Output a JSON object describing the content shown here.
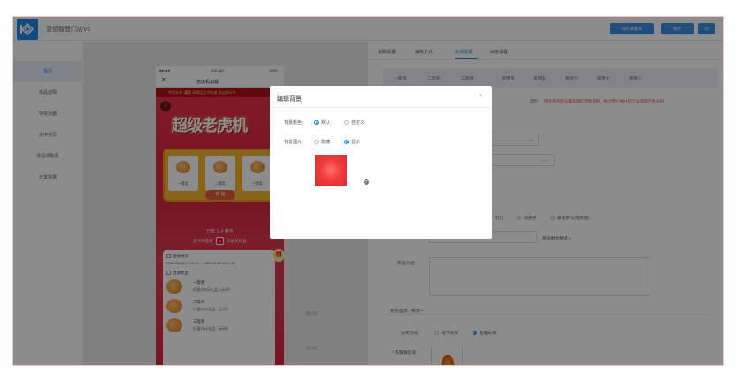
{
  "app": {
    "title": "壹佰智慧门店V2",
    "buttons": {
      "save_publish": "保存并发布",
      "save": "保存",
      "extra": "◎"
    }
  },
  "sidebar": {
    "items": [
      {
        "label": "首页",
        "active": true
      },
      {
        "label": "奖品详情"
      },
      {
        "label": "中奖页面"
      },
      {
        "label": "没中奖页"
      },
      {
        "label": "奖品领取页"
      },
      {
        "label": "分享效果"
      }
    ]
  },
  "phone": {
    "status_signal": "●●●●●",
    "status_time": "1:21 AM",
    "status_battery": "100%",
    "nav_close": "✕",
    "nav_title": "老虎机加载",
    "notice": "中奖名单: 嘉斯 获得奖品中奖者    活动进行中",
    "hero_title": "超级老虎机",
    "slots": [
      "一等奖",
      "二等奖",
      "三等奖"
    ],
    "start_button": "开 始",
    "participants": "已有 1 人参与",
    "chances_prefix": "您今天还有",
    "chances_count": "3",
    "chances_suffix": "次抽奖机会",
    "card": {
      "time_title": "活动时间",
      "time_range": "2021-09-26 11:14:54 ~ 2021-10-03 11:14:54",
      "prize_title": "活动奖品",
      "prizes": [
        {
          "name": "一等奖",
          "value": "价值100元礼品（示例）"
        },
        {
          "name": "二等奖",
          "value": "价值50元礼品（示例）"
        },
        {
          "name": "三等奖",
          "value": "价值10元礼品（示例）"
        }
      ]
    }
  },
  "hints": {
    "a": "提示项",
    "b": "提示项"
  },
  "settings": {
    "tabs": [
      "基础设置",
      "抽奖方式",
      "奖项设置",
      "高级设置"
    ],
    "active_tab": 2,
    "subtabs": [
      "一等奖",
      "二等奖",
      "三等奖",
      "奖项四",
      "奖项五",
      "奖项六",
      "奖项七",
      "奖项八"
    ],
    "tip_label": "提示:",
    "tip_text": "所有奖项的设置或真实奖项名称，防止用户抽中后无法领取产生纠纷",
    "counter_name": "0/5",
    "counter_desc": "0/24",
    "prize_type_options": [
      "积分",
      "优惠券",
      "谢谢参与(无奖励)"
    ],
    "remaining_label": "奖品剩余数量 !",
    "intro_label": "奖品介绍:",
    "redeem_section": "兑奖选项：奖项一",
    "redeem_label": "兑奖方式:",
    "redeem_options": [
      "线下兑奖",
      "客服兑奖"
    ],
    "wechat_label": "* 客服微信号:"
  },
  "modal": {
    "title": "编辑背景",
    "close": "×",
    "color_label": "背景颜色:",
    "color_options": [
      "默认",
      "自定义"
    ],
    "image_label": "背景图片:",
    "image_options": [
      "隐藏",
      "显示"
    ],
    "help": "?"
  }
}
